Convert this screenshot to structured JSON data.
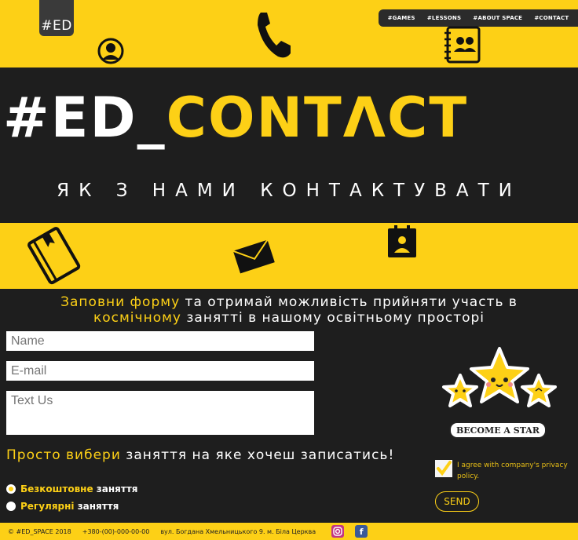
{
  "header": {
    "logo": "#ED",
    "nav": [
      "#GAMES",
      "#LESSONS",
      "#ABOUT SPACE",
      "#CONTACT"
    ]
  },
  "hero": {
    "title_white": "#ED_",
    "title_yellow": "CONTΛCT",
    "subtitle": "ЯК З НАМИ КОНТАКТУВАТИ"
  },
  "intro": {
    "hl1": "Заповни форму",
    "t1": " та отримай можливість прийняти участь в ",
    "hl2": "космічному",
    "t2": " занятті в нашому освітньому просторі"
  },
  "form": {
    "name_placeholder": "Name",
    "email_placeholder": "E-mail",
    "text_placeholder": "Text Us"
  },
  "choose": {
    "hl": "Просто вибери",
    "rest": " заняття на яке хочеш записатись!"
  },
  "options": [
    {
      "hl": "Безкоштовне",
      "rest": " заняття",
      "selected": true
    },
    {
      "hl": "Регулярні",
      "rest": " заняття",
      "selected": false
    }
  ],
  "star": {
    "label": "BECOME A STAR"
  },
  "agree": {
    "text": "I agree with company's privacy policy.",
    "checked": true
  },
  "send_label": "SEND",
  "footer": {
    "copyright": "© #ED_SPACE 2018",
    "phone": "+380-(00)-000-00-00",
    "address": "вул. Богдана Хмельницького 9. м. Біла Церква"
  },
  "colors": {
    "accent": "#fdd016",
    "dark": "#1e1e1e"
  }
}
